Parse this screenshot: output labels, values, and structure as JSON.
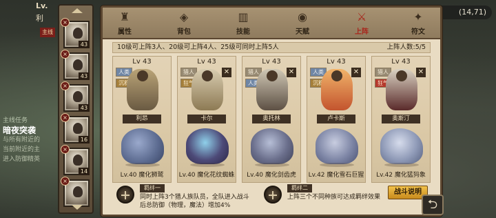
{
  "background": {
    "top_left_line1": "Lv.",
    "top_left_line2": "利",
    "red_tag": "主线",
    "coords": "(14,71)",
    "quest": {
      "title": "主线任务",
      "heading": "暗夜突袭",
      "lines": [
        "与所有附近的",
        "当前附近的主",
        "进入防御精英"
      ]
    }
  },
  "hero_column": {
    "slots": [
      {
        "name": "hero-slot-1",
        "level": "43",
        "remove": "×"
      },
      {
        "name": "hero-slot-2",
        "level": "43",
        "remove": "×"
      },
      {
        "name": "hero-slot-3",
        "level": "43",
        "remove": "×"
      },
      {
        "name": "hero-slot-4",
        "level": "16",
        "remove": "×"
      },
      {
        "name": "hero-slot-5",
        "level": "14",
        "remove": "×"
      },
      {
        "name": "hero-slot-6",
        "level": "",
        "remove": "×"
      }
    ]
  },
  "tabs": [
    {
      "label": "属性",
      "icon": "♜",
      "active": false
    },
    {
      "label": "背包",
      "icon": "◈",
      "active": false
    },
    {
      "label": "技能",
      "icon": "▥",
      "active": false
    },
    {
      "label": "天赋",
      "icon": "◉",
      "active": false
    },
    {
      "label": "上阵",
      "icon": "⚔",
      "active": true
    },
    {
      "label": "符文",
      "icon": "✦",
      "active": false
    }
  ],
  "info_bar": {
    "text": "10级可上阵3人、20级可上阵4人、25级可同时上阵5人",
    "slots": "上阵人数:5/5"
  },
  "cards": [
    {
      "level": "Lv 43",
      "tags": [
        {
          "text": "人类",
          "color": "blue"
        },
        {
          "text": "沉稳",
          "color": "gold"
        }
      ],
      "has_close": false,
      "hero_name": "利昂",
      "hero_color": "#6a5a42",
      "beast_name": "Lv.40 魔化狮鹫",
      "beast_color": "#5b6a8f"
    },
    {
      "level": "Lv 43",
      "tags": [
        {
          "text": "猎人",
          "color": "grey"
        },
        {
          "text": "狂气",
          "color": "gold"
        }
      ],
      "has_close": true,
      "hero_name": "卡尔",
      "hero_color": "#8d7a54",
      "beast_name": "Lv.40 魔化花纹蜘蛛",
      "beast_color": "#4d4a78"
    },
    {
      "level": "Lv 43",
      "tags": [
        {
          "text": "猎人",
          "color": "grey"
        },
        {
          "text": "人类",
          "color": "blue"
        }
      ],
      "has_close": true,
      "hero_name": "奥托林",
      "hero_color": "#5d5044",
      "beast_name": "Lv.40 魔化剑齿虎",
      "beast_color": "#6b6f8c"
    },
    {
      "level": "Lv 43",
      "tags": [
        {
          "text": "人类",
          "color": "blue"
        },
        {
          "text": "沉稳",
          "color": "gold"
        }
      ],
      "has_close": true,
      "hero_name": "卢卡斯",
      "hero_color": "#c3542e",
      "beast_name": "Lv.42 魔化雪石巨猩",
      "beast_color": "#7e86a6"
    },
    {
      "level": "Lv 43",
      "tags": [
        {
          "text": "猎人",
          "color": "grey"
        },
        {
          "text": "狂气",
          "color": "red"
        }
      ],
      "has_close": true,
      "hero_name": "奥斯汀",
      "hero_color": "#5a2a2a",
      "beast_name": "Lv.42 魔化猛犸象",
      "beast_color": "#8f9ab7"
    }
  ],
  "bonds": [
    {
      "title": "羁绊一",
      "text_line1": "同时上阵3个猎人族队员，全队进入战斗",
      "text_line2": "后总防御（物理，魔法）增加4%"
    },
    {
      "title": "羁绊二",
      "text_line1": "上阵三个不同种族可达成羁绊效果",
      "text_line2": ""
    }
  ],
  "battle_button": "战斗说明",
  "close_glyph": "✕",
  "back_glyph": "⮌"
}
